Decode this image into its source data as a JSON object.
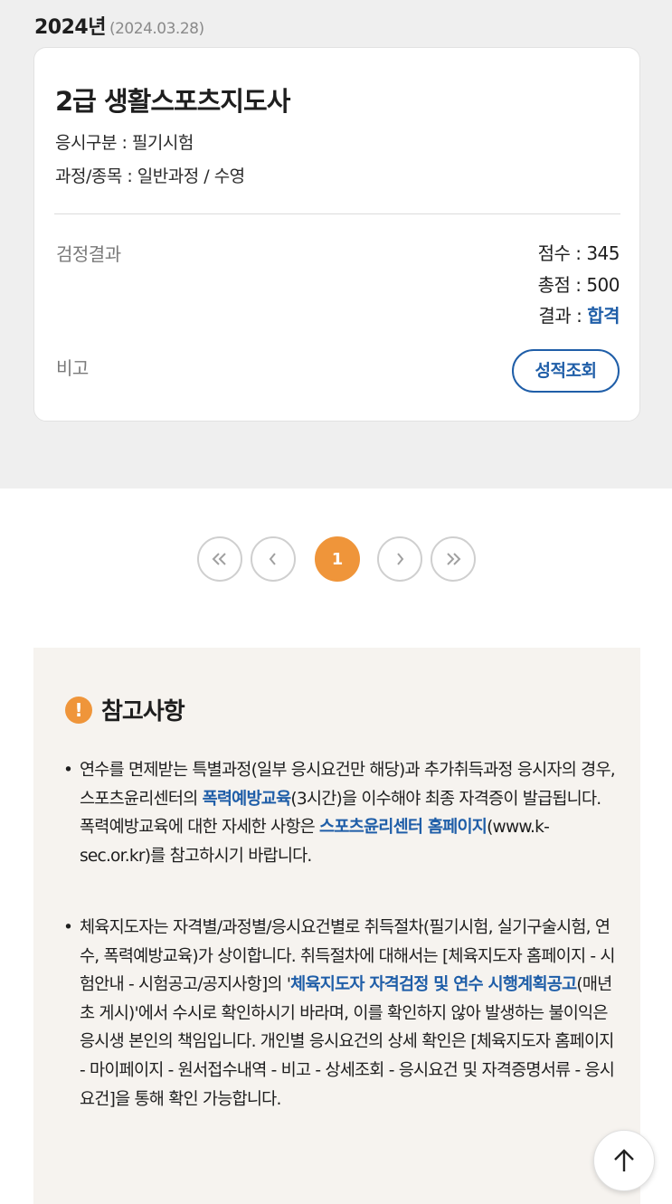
{
  "exam": {
    "year": "2024년",
    "date": "(2024.03.28)",
    "title": "2급 생활스포츠지도사",
    "category": "응시구분 : 필기시험",
    "course": "과정/종목 : 일반과정 / 수영",
    "result_label": "검정결과",
    "score": "점수 : 345",
    "total": "총점 : 500",
    "result_prefix": "결과 : ",
    "result_value": "합격",
    "note_label": "비고",
    "grade_button": "성적조회"
  },
  "pagination": {
    "current_page": "1",
    "icons": [
      "first-page-icon",
      "prev-page-icon",
      "next-page-icon",
      "last-page-icon"
    ]
  },
  "notice": {
    "icon_symbol": "!",
    "title": "참고사항",
    "bullet": "•",
    "item1": {
      "p1": "연수를 면제받는 특별과정(일부 응시요건만 해당)과 추가취득과정 응시자의 경우, 스포츠윤리센터의 ",
      "link1": "폭력예방교육",
      "p2": "(3시간)을 이수해야 최종 자격증이 발급됩니다. 폭력예방교육에 대한 자세한 사항은 ",
      "link2": "스포츠윤리센터 홈페이지",
      "p3": "(www.k-sec.or.kr)를 참고하시기 바랍니다."
    },
    "item2": {
      "p1": "체육지도자는 자격별/과정별/응시요건별로 취득절차(필기시험, 실기구술시험, 연수, 폭력예방교육)가 상이합니다. 취득절차에 대해서는 [체육지도자 홈페이지 - 시험안내 - 시험공고/공지사항]의 '",
      "link1": "체육지도자 자격검정 및 연수 시행계획공고",
      "p2": "(매년 초 게시)'에서 수시로 확인하시기 바라며, 이를 확인하지 않아 발생하는 불이익은 응시생 본인의 책임입니다. 개인별 응시요건의 상세 확인은 [체육지도자 홈페이지 - 마이페이지 - 원서접수내역 - 비고 - 상세조회 - 응시요건 및 자격증명서류 - 응시요건]을 통해 확인 가능합니다."
    }
  },
  "colors": {
    "accent_orange": "#ef953a",
    "link_blue": "#1f5ea8",
    "gray_bg": "#efefef",
    "notice_bg": "#f6f3ef"
  },
  "scroll_top_icon": "arrow-up-icon"
}
